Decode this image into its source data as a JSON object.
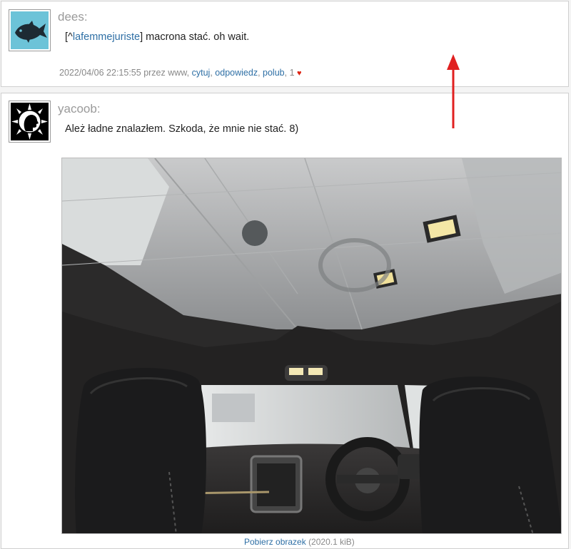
{
  "posts": [
    {
      "author": "dees:",
      "body": {
        "mention_prefix": "[^",
        "mention": "lafemmejuriste",
        "mention_suffix": "]",
        "text": " macrona stać. oh wait."
      },
      "meta": {
        "datetime": "2022/04/06 22:15:55",
        "by_label": "przez",
        "by_user": "www",
        "actions": [
          "cytuj",
          "odpowiedz",
          "polub"
        ],
        "likes": "1",
        "heart": "♥"
      }
    },
    {
      "author": "yacoob:",
      "body": {
        "text": "Ależ ładne znalazłem. Szkoda, że mnie nie stać. 8)"
      },
      "caption": {
        "link": "Pobierz obrazek",
        "size": "(2020.1 kiB)"
      }
    }
  ],
  "colors": {
    "link": "#2e6fa5",
    "username": "#9a9a9a",
    "meta": "#888888",
    "heart": "#dd1111",
    "arrow": "#e02020"
  },
  "icons": {
    "avatar_1": "fish-icon",
    "avatar_2": "head-with-rays-icon",
    "annotation": "red-up-arrow"
  }
}
